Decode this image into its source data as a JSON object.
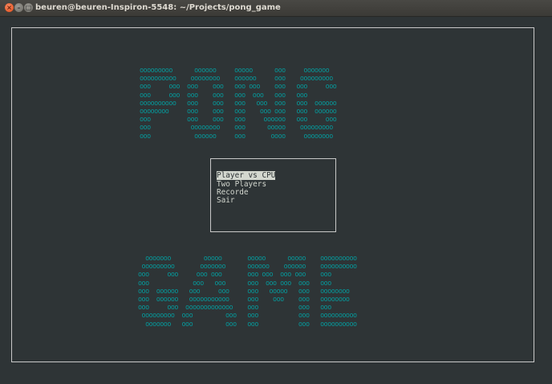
{
  "window": {
    "title": "beuren@beuren-Inspiron-5548: ~/Projects/pong_game",
    "controls": [
      "×",
      "–",
      "□"
    ]
  },
  "banner_top": {
    "lines": [
      "ooooooooo      oooooo     ooooo      ooo     ooooooo",
      "oooooooooo    oooooooo    oooooo     ooo    ooooooooo",
      "ooo     ooo  ooo    ooo   ooo ooo    ooo   ooo     ooo",
      "ooo     ooo  ooo    ooo   ooo  ooo   ooo   ooo",
      "oooooooooo   ooo    ooo   ooo   ooo  ooo   ooo  oooooo",
      "oooooooo     ooo    ooo   ooo    ooo ooo   ooo  oooooo",
      "ooo          ooo    ooo   ooo     oooooo   ooo     ooo",
      "ooo           oooooooo    ooo      ooooo    ooooooooo",
      "ooo            oooooo     ooo       oooo     oooooooo"
    ]
  },
  "menu": {
    "items": [
      {
        "label": "Player vs CPU",
        "selected": true
      },
      {
        "label": "Two Players",
        "selected": false
      },
      {
        "label": "Recorde",
        "selected": false
      },
      {
        "label": "Sair",
        "selected": false
      }
    ]
  },
  "banner_bottom": {
    "lines": [
      "  ooooooo         ooooo       ooooo      ooooo    oooooooooo",
      " ooooooooo       ooooooo      oooooo    oooooo    oooooooooo",
      "ooo     ooo     ooo ooo       ooo ooo  ooo ooo    ooo",
      "ooo            ooo   ooo      ooo  ooo ooo  ooo   ooo",
      "ooo  oooooo   ooo     ooo     ooo   ooooo   ooo   oooooooo",
      "ooo  oooooo   ooooooooooo     ooo    ooo    ooo   oooooooo",
      "ooo     ooo  ooooooooooooo    ooo           ooo   ooo",
      " ooooooooo  ooo         ooo   ooo           ooo   oooooooooo",
      "  ooooooo   ooo         ooo   ooo           ooo   oooooooooo"
    ]
  },
  "colors": {
    "terminal_bg": "#2e3436",
    "ascii_art": "#06989a",
    "text": "#d3d7cf",
    "border": "#c8c8c8"
  }
}
